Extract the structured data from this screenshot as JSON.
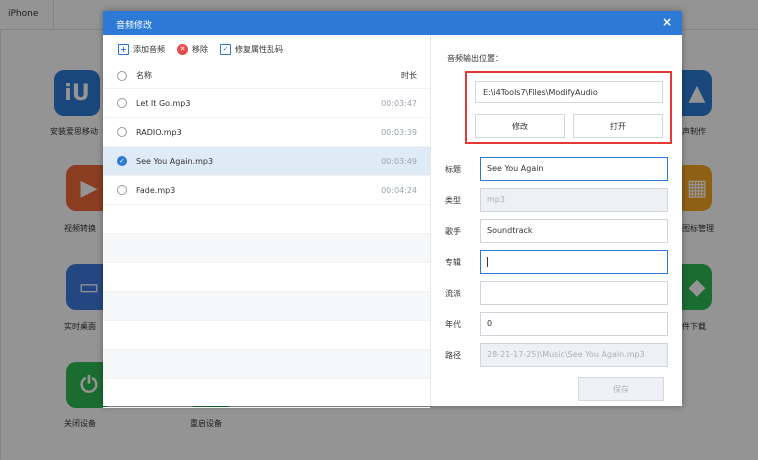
{
  "background": {
    "tab_label": "iPhone",
    "tools": [
      {
        "name": "ringtone-app",
        "label": "安装爱思移动",
        "color": "#2d7ad6",
        "glyph": "iU"
      },
      {
        "name": "video-convert",
        "label": "视频转换",
        "color": "#f06a3a",
        "glyph": "▶"
      },
      {
        "name": "realtime-desktop",
        "label": "实时桌面",
        "color": "#3e7be0",
        "glyph": "▭"
      },
      {
        "name": "shutdown",
        "label": "关闭设备",
        "color": "#2fbb55",
        "glyph": "⏻"
      },
      {
        "name": "reboot",
        "label": "重启设备",
        "color": "#2fbb55",
        "glyph": ""
      },
      {
        "name": "ringtone-make",
        "label": "铃声制作",
        "color": "#2d7ad6",
        "glyph": "🔔"
      },
      {
        "name": "icon-manage",
        "label": "整理图标管理",
        "color": "#f5a623",
        "glyph": "▦"
      },
      {
        "name": "firmware-download",
        "label": "固件下载",
        "color": "#2fbb55",
        "glyph": "◆"
      }
    ]
  },
  "dialog": {
    "title": "音频修改",
    "close_glyph": "×",
    "toolbar": {
      "add_label": "添加音频",
      "remove_label": "移除",
      "fix_label": "修复属性乱码"
    },
    "list": {
      "header_name": "名称",
      "header_duration": "时长",
      "rows": [
        {
          "name": "Let It Go.mp3",
          "duration": "00:03:47",
          "selected": false
        },
        {
          "name": "RADIO.mp3",
          "duration": "00:03:39",
          "selected": false
        },
        {
          "name": "See You Again.mp3",
          "duration": "00:03:49",
          "selected": true
        },
        {
          "name": "Fade.mp3",
          "duration": "00:04:24",
          "selected": false
        }
      ]
    },
    "output": {
      "label": "音频输出位置：",
      "path": "E:\\i4Tools7\\Files\\ModifyAudio",
      "modify_label": "修改",
      "open_label": "打开"
    },
    "fields": {
      "title_label": "标题",
      "title_value": "See You Again",
      "type_label": "类型",
      "type_value": "mp3",
      "artist_label": "歌手",
      "artist_value": "Soundtrack",
      "album_label": "专辑",
      "album_value": "",
      "genre_label": "流派",
      "genre_value": "",
      "year_label": "年代",
      "year_value": "0",
      "path_label": "路径",
      "path_value": "28-21-17-25)\\Music\\See You Again.mp3"
    },
    "save_label": "保存"
  },
  "colors": {
    "accent": "#2d7ad6",
    "highlight_box": "#e53935",
    "selected_row": "#dfeaf7"
  }
}
